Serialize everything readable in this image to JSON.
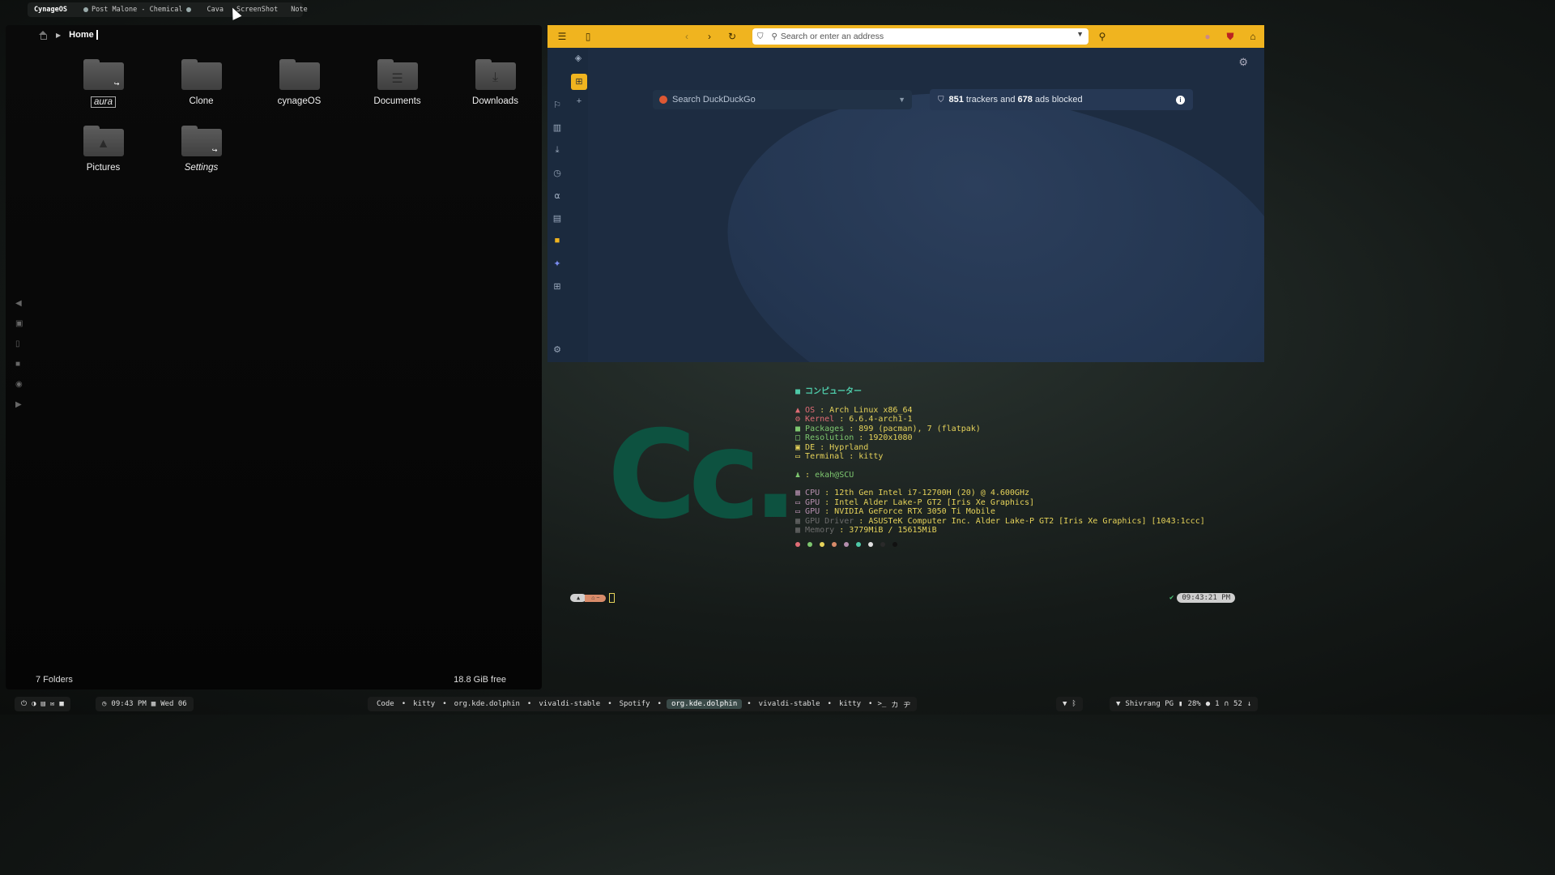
{
  "topbar": {
    "brand": "CynageOS",
    "music": "Post Malone - Chemical",
    "items": [
      "Cava",
      "ScreenShot",
      "Note"
    ]
  },
  "file_manager": {
    "breadcrumb": "Home",
    "folders": [
      {
        "name": "aura",
        "icon": "folder-link-icon"
      },
      {
        "name": "Clone",
        "icon": "folder-icon"
      },
      {
        "name": "cynageOS",
        "icon": "folder-icon"
      },
      {
        "name": "Documents",
        "icon": "folder-documents-icon"
      },
      {
        "name": "Downloads",
        "icon": "folder-download-icon"
      },
      {
        "name": "Pictures",
        "icon": "folder-pictures-icon"
      },
      {
        "name": "Settings",
        "icon": "folder-link-icon"
      }
    ],
    "status_count": "7 Folders",
    "status_free": "18.8 GiB free"
  },
  "browser": {
    "address_placeholder": "Search or enter an address",
    "search_placeholder": "Search DuckDuckGo",
    "trackers_count": "851",
    "trackers_text": " trackers and ",
    "ads_count": "678",
    "ads_text": " ads blocked",
    "accent_color": "#f0b41f"
  },
  "terminal": {
    "ascii_logo": "Cc.",
    "host_title": "コンピューター",
    "os_label": "OS",
    "os_value": "Arch Linux x86_64",
    "kernel_label": "Kernel",
    "kernel_value": "6.6.4-arch1-1",
    "packages_label": "Packages",
    "packages_value": "899 (pacman), 7 (flatpak)",
    "resolution_label": "Resolution",
    "resolution_value": "1920x1080",
    "de_label": "DE",
    "de_value": "Hyprland",
    "terminal_label": "Terminal",
    "terminal_value": "kitty",
    "user_value": "ekah@SCU",
    "cpu_label": "CPU",
    "cpu_value": "12th Gen Intel i7-12700H (20) @ 4.600GHz",
    "gpu1_label": "GPU",
    "gpu1_value": "Intel Alder Lake-P GT2 [Iris Xe Graphics]",
    "gpu2_label": "GPU",
    "gpu2_value": "NVIDIA GeForce RTX 3050 Ti Mobile",
    "gpudriver_label": "GPU Driver",
    "gpudriver_value": "ASUSTeK Computer Inc. Alder Lake-P GT2 [Iris Xe Graphics] [1043:1ccc]",
    "memory_label": "Memory",
    "memory_value": "3779MiB / 15615MiB",
    "palette": [
      "#e06c75",
      "#7ec76f",
      "#e6d35a",
      "#d88b6a",
      "#b48ead",
      "#4ec9a8",
      "#e0e0e0",
      "#2a2a2a",
      "#111111"
    ],
    "prompt_time": "09:43:21 PM"
  },
  "bottombar": {
    "clock": "09:43 PM",
    "date": "Wed 06",
    "workspaces": [
      "Code",
      "kitty",
      "org.kde.dolphin",
      "vivaldi-stable",
      "Spotify",
      "org.kde.dolphin",
      "vivaldi-stable",
      "kitty"
    ],
    "active_workspace": 5,
    "wifi": "Shivrang PG",
    "battery": "28%",
    "notifications": "1",
    "volume": "52"
  }
}
